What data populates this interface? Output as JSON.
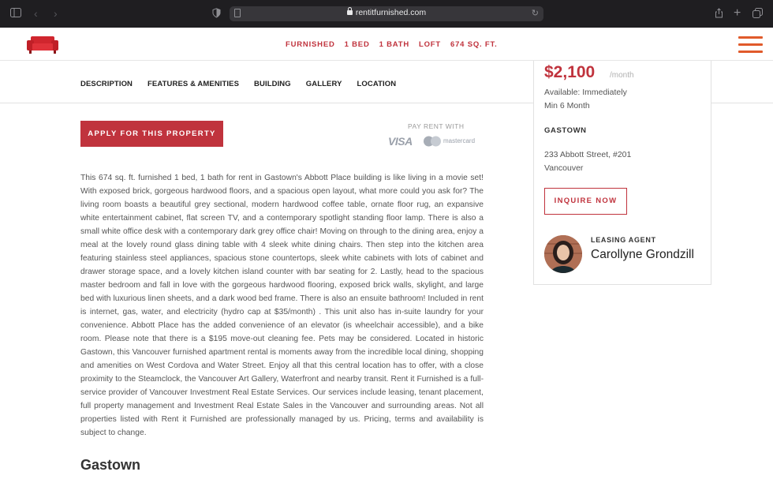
{
  "browser": {
    "url": "rentitfurnished.com"
  },
  "header": {
    "chips": [
      "FURNISHED",
      "1 BED",
      "1 BATH",
      "LOFT",
      "674 SQ. FT."
    ]
  },
  "tabs": [
    "DESCRIPTION",
    "FEATURES & AMENITIES",
    "BUILDING",
    "GALLERY",
    "LOCATION"
  ],
  "main": {
    "apply_label": "APPLY FOR THIS PROPERTY",
    "pay_rent_with": "PAY RENT WITH",
    "visa": "VISA",
    "mastercard": "mastercard",
    "description": "This 674 sq. ft. furnished 1 bed, 1 bath for rent in Gastown's Abbott Place building is like living in a movie set! With exposed brick, gorgeous hardwood floors, and a spacious open layout, what more could you ask for? The living room boasts a beautiful grey sectional, modern hardwood coffee table, ornate floor rug, an expansive white entertainment cabinet, flat screen TV, and a contemporary spotlight standing floor lamp. There is also a small white office desk with a contemporary dark grey office chair! Moving on through to the dining area, enjoy a meal at the lovely round glass dining table with 4 sleek white dining chairs. Then step into the kitchen area featuring stainless steel appliances, spacious stone countertops, sleek white cabinets with lots of cabinet and drawer storage space, and a lovely kitchen island counter with bar seating for 2. Lastly, head to the spacious master bedroom and fall in love with the gorgeous hardwood flooring, exposed brick walls, skylight, and large bed with luxurious linen sheets, and a dark wood bed frame. There is also an ensuite bathroom! Included in rent is internet, gas, water, and electricity (hydro cap at $35/month) . This unit also has in-suite laundry for your convenience. Abbott Place has the added convenience of an elevator (is wheelchair accessible), and a bike room. Please note that there is a $195 move-out cleaning fee. Pets may be considered. Located in historic Gastown, this Vancouver furnished apartment rental is moments away from the incredible local dining, shopping and amenities on West Cordova and Water Street. Enjoy all that this central location has to offer, with a close proximity to the Steamclock, the Vancouver Art Gallery, Waterfront and nearby transit. Rent it Furnished is a full-service provider of Vancouver Investment Real Estate Services. Our services include leasing, tenant placement, full property management and Investment Real Estate Sales in the Vancouver and surrounding areas. Not all properties listed with Rent it Furnished are professionally managed by us. Pricing, terms and availability is subject to change.",
    "section_title": "Gastown"
  },
  "card": {
    "price": "$2,100",
    "per": "/month",
    "available": "Available: Immediately",
    "min_term": "Min 6 Month",
    "neighbourhood": "GASTOWN",
    "address_line1": "233 Abbott Street, #201",
    "address_line2": "Vancouver",
    "inquire_label": "INQUIRE NOW",
    "agent_label": "LEASING AGENT",
    "agent_name": "Carollyne Grondzill"
  },
  "colors": {
    "brand_red": "#c0333d",
    "menu_orange": "#e05a2b"
  }
}
